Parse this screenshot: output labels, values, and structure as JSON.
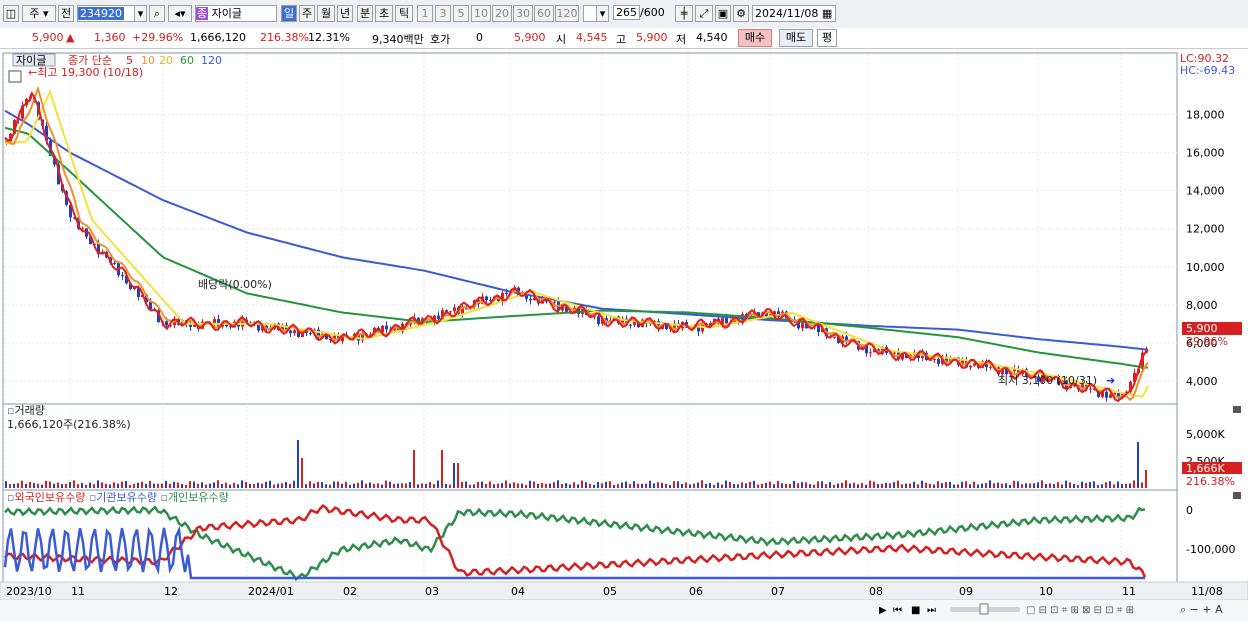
{
  "toolbar": {
    "market": "주",
    "prev": "전",
    "code": "234920",
    "name": "자이글",
    "name_badge": "종",
    "period_tabs": [
      "일",
      "주",
      "월",
      "년",
      "분",
      "초",
      "틱"
    ],
    "active_period": "일",
    "minute_tabs": [
      "1",
      "3",
      "5",
      "10",
      "20",
      "30",
      "60",
      "120"
    ],
    "count": "265",
    "max_count": "/600",
    "date": "2024/11/08"
  },
  "quote": {
    "price": "5,900",
    "change": "1,360",
    "change_pct": "+29.96%",
    "volume": "1,666,120",
    "volume_ratio": "216.38%",
    "turnover_rate": "12.31%",
    "amount": "9,340백만",
    "hoga_label": "호가",
    "hoga_value": "0",
    "hoga_price": "5,900",
    "open_label": "시",
    "open": "4,545",
    "high_label": "고",
    "high": "5,900",
    "low_label": "저",
    "low": "4,540",
    "buy": "매수",
    "sell": "매도",
    "avg": "평"
  },
  "price_panel": {
    "name_tag": "자이글",
    "ma_label": "종가 단순",
    "ma_periods": [
      "5",
      "10",
      "20",
      "60",
      "120"
    ],
    "ma_colors": {
      "5": "#e02020",
      "10": "#f0902a",
      "20": "#f2e23a",
      "60": "#23963a",
      "120": "#3a5ad6"
    },
    "max_annot": "최고 19,300 (10/18)",
    "min_annot": "최저 3,100 (10/31)",
    "dividend_annot": "배당락(0.00%)",
    "lc": "LC:90.32",
    "hc": "HC:-69.43",
    "price_tag": "5,900",
    "pct_tag": "29.96%",
    "y_ticks": [
      "18,000",
      "16,000",
      "14,000",
      "12,000",
      "10,000",
      "8,000",
      "6,000",
      "4,000"
    ]
  },
  "volume_panel": {
    "title": "거래량",
    "value_text": "1,666,120주(216.38%)",
    "y_ticks": [
      "5,000K",
      "2,500K"
    ],
    "tag": "1,666K",
    "tag_pct": "216.38%"
  },
  "holding_panel": {
    "legend": [
      "외국인보유수량",
      "기관보유수량",
      "개인보유수량"
    ],
    "legend_colors": [
      "#d42020",
      "#3a5ad6",
      "#2e8c4c"
    ],
    "y_ticks": [
      "0",
      "-100,000"
    ]
  },
  "x_axis": {
    "labels": [
      "2023/10",
      "11",
      "12",
      "2024/01",
      "02",
      "03",
      "04",
      "05",
      "06",
      "07",
      "08",
      "09",
      "10",
      "11",
      "11/08"
    ]
  },
  "chart_data": {
    "type": "line",
    "title": "",
    "series": [
      {
        "name": "종가",
        "x": [
          "2023/10",
          "2023/10/18",
          "2023/11",
          "2023/12",
          "2024/01",
          "2024/02",
          "2024/03",
          "2024/04",
          "2024/05",
          "2024/06",
          "2024/07",
          "2024/08",
          "2024/09",
          "2024/10",
          "2024/10/31",
          "2024/11/08"
        ],
        "values": [
          16500,
          19300,
          12500,
          7000,
          7000,
          6200,
          7200,
          8700,
          7200,
          6800,
          7600,
          5600,
          5000,
          4200,
          3100,
          5900
        ]
      },
      {
        "name": "120",
        "values": [
          18200,
          17500,
          16000,
          13500,
          11800,
          10500,
          9800,
          8700,
          7800,
          7500,
          7200,
          6900,
          6700,
          6200,
          5800,
          5650
        ]
      },
      {
        "name": "60",
        "values": [
          17300,
          17000,
          15000,
          10500,
          8600,
          7600,
          7100,
          7400,
          7700,
          7600,
          7300,
          6800,
          6300,
          5500,
          4900,
          4700
        ]
      }
    ],
    "ylim": [
      3000,
      19500
    ]
  }
}
